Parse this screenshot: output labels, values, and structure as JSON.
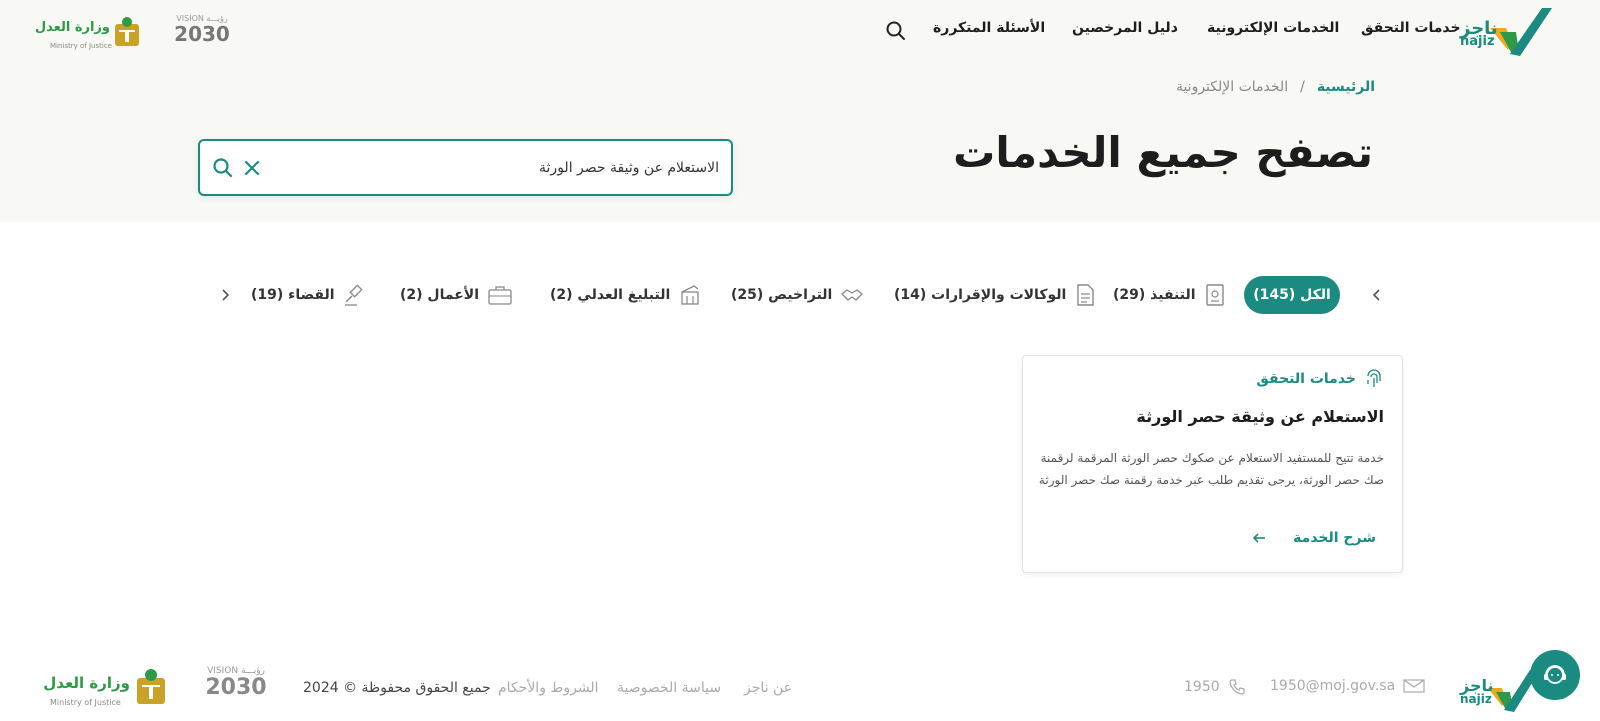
{
  "header": {
    "logo_text_ar": "ناجز",
    "logo_text_en": "najiz",
    "nav": [
      "خدمات التحقق",
      "الخدمات الإلكترونية",
      "دليل المرخصين",
      "الأسئلة المتكررة"
    ],
    "vision_label": "VISION",
    "vision_ar": "رؤيـــة",
    "vision_year": "2030",
    "moj_ar": "وزارة العدل",
    "moj_en": "Ministry of Justice"
  },
  "breadcrumb": {
    "home": "الرئيسية",
    "separator": "/",
    "current": "الخدمات الإلكترونية"
  },
  "page_title": "تصفح جميع الخدمات",
  "search": {
    "value": "الاستعلام عن وثيقة حصر الورثة"
  },
  "tabs": [
    {
      "label": "الكل (145)"
    },
    {
      "label": "التنفيذ (29)"
    },
    {
      "label": "الوكالات والإقرارات (14)"
    },
    {
      "label": "التراخيص (25)"
    },
    {
      "label": "التبليغ العدلي (2)"
    },
    {
      "label": "الأعمال (2)"
    },
    {
      "label": "القضاء (19)"
    }
  ],
  "card": {
    "category": "خدمات التحقق",
    "title": "الاستعلام عن وثيقة حصر الورثة",
    "description": "خدمة تتيح للمستفيد الاستعلام عن صكوك حصر الورثة المرقمة لرقمنة صك حصر الورثة، يرجى تقديم طلب عبر خدمة رقمنة صك حصر الورثة",
    "link": "شرح الخدمة"
  },
  "footer": {
    "email": "1950@moj.gov.sa",
    "phone": "1950",
    "links": [
      "عن ناجز",
      "سياسة الخصوصية",
      "الشروط والأحكام"
    ],
    "copyright": "جميع الحقوق محفوظة © 2024"
  },
  "colors": {
    "accent": "#1b8a80",
    "header_bg": "#f8f8f5",
    "gold": "#c9a227",
    "green": "#2e9a48"
  }
}
